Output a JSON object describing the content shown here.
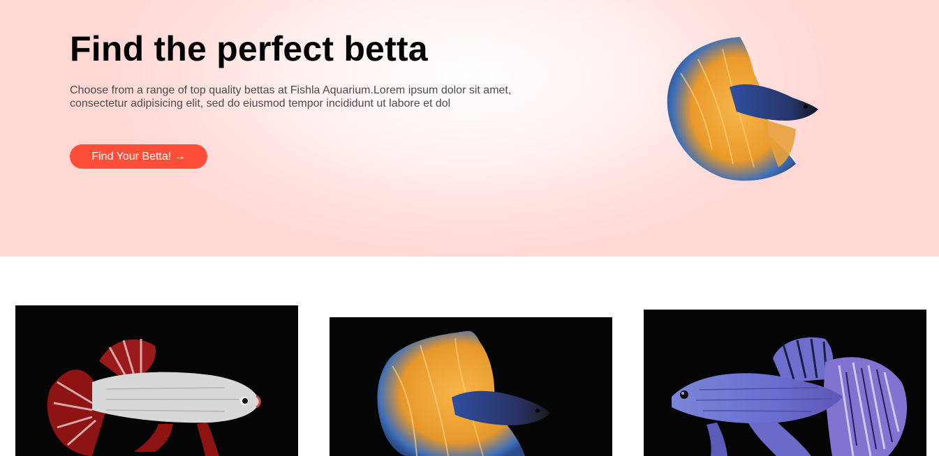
{
  "hero": {
    "title": "Find the perfect betta",
    "desc_line1": "Choose from a range of top quality bettas at Fishla Aquarium.Lorem ipsum dolor sit amet,",
    "desc_line2": "consectetur adipisicing elit, sed do eiusmod tempor incididunt ut labore et dol",
    "cta_label": "Find Your Betta! →",
    "image": "betta-fish-orange-blue"
  },
  "products": [
    {
      "image": "betta-fish-white-red"
    },
    {
      "image": "betta-fish-orange-blue"
    },
    {
      "image": "betta-fish-blue-purple"
    }
  ],
  "colors": {
    "accent": "#ff4f3a",
    "hero_bg": "#ffdfdc",
    "card_bg": "#050505"
  }
}
